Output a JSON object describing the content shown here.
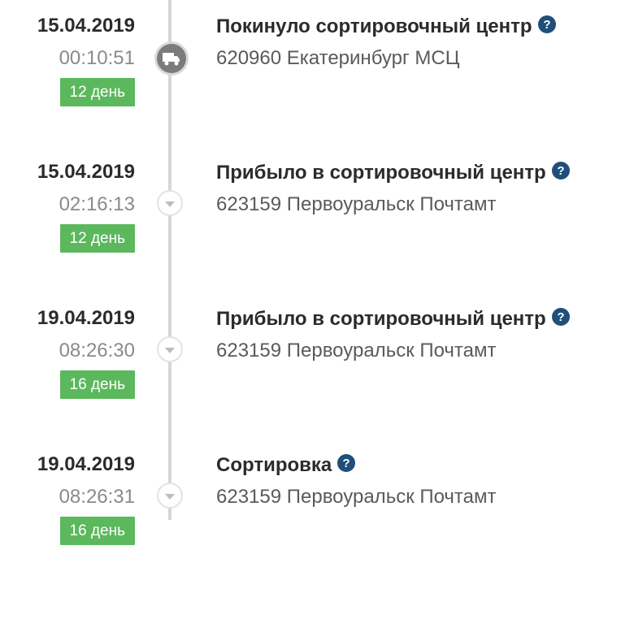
{
  "events": [
    {
      "date": "15.04.2019",
      "time": "00:10:51",
      "day_badge": "12 день",
      "status": "Покинуло сортировочный центр",
      "location": "620960 Екатеринбург МСЦ",
      "marker_icon": "truck-icon"
    },
    {
      "date": "15.04.2019",
      "time": "02:16:13",
      "day_badge": "12 день",
      "status": "Прибыло в сортировочный центр",
      "location": "623159 Первоуральск Почтамт",
      "marker_icon": "chevron-down-icon"
    },
    {
      "date": "19.04.2019",
      "time": "08:26:30",
      "day_badge": "16 день",
      "status": "Прибыло в сортировочный центр",
      "location": "623159 Первоуральск Почтамт",
      "marker_icon": "chevron-down-icon"
    },
    {
      "date": "19.04.2019",
      "time": "08:26:31",
      "day_badge": "16 день",
      "status": "Сортировка",
      "location": "623159 Первоуральск Почтамт",
      "marker_icon": "chevron-down-icon"
    }
  ],
  "colors": {
    "badge_green": "#5cb85c",
    "help_icon_blue": "#1f4f7a",
    "timeline_gray": "#d6d6d6"
  }
}
